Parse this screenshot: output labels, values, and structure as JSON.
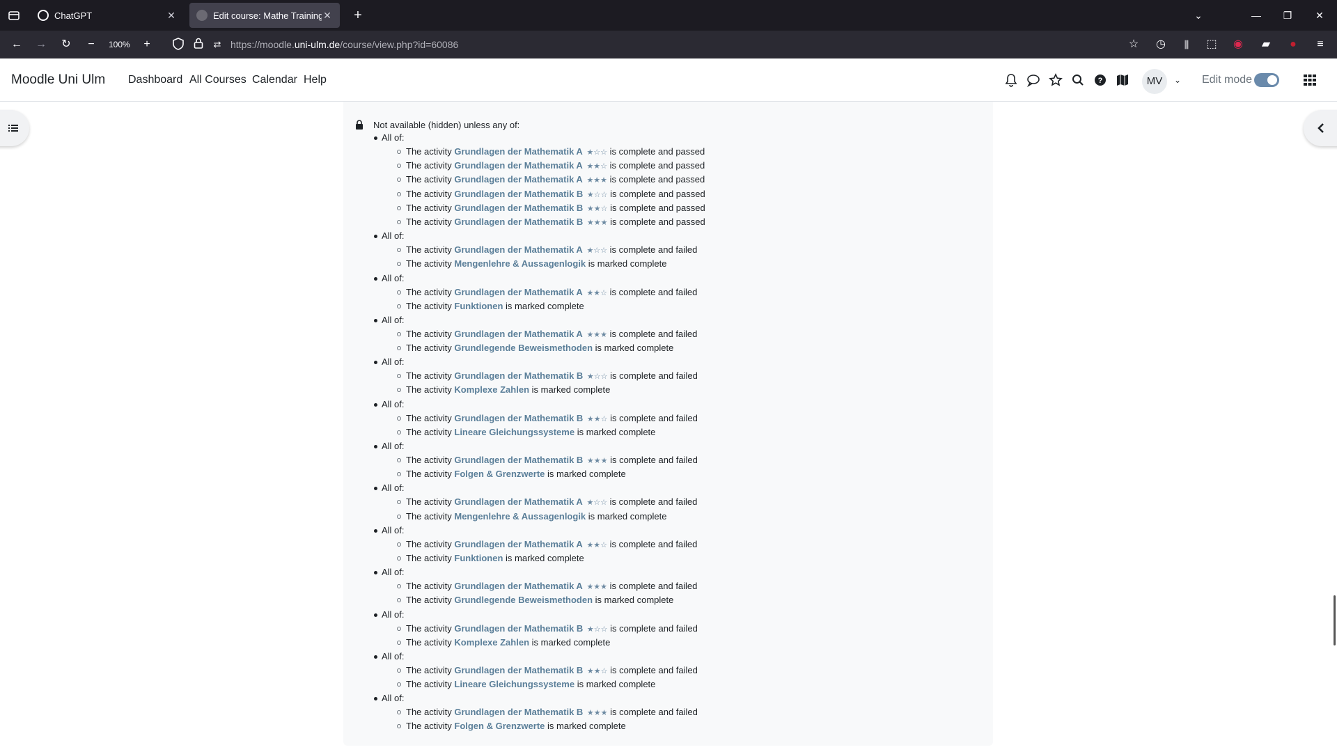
{
  "browser": {
    "tabs": [
      {
        "title": "ChatGPT",
        "active": false
      },
      {
        "title": "Edit course: Mathe Training | Mo",
        "active": true
      }
    ],
    "zoom": "100%",
    "url_prefix": "https://moodle.",
    "url_domain": "uni-ulm.de",
    "url_path": "/course/view.php?id=60086"
  },
  "moodle": {
    "brand": "Moodle Uni Ulm",
    "nav": [
      "Dashboard",
      "All Courses",
      "Calendar",
      "Help"
    ],
    "user_initials": "MV",
    "edit_mode_label": "Edit mode",
    "edit_mode_on": true
  },
  "restriction": {
    "heading": "Not available (hidden) unless any of:",
    "group_label": "All of:",
    "prefix": "The activity",
    "groups": [
      {
        "conditions": [
          {
            "activity": "Grundlagen der Mathematik A",
            "stars": "★☆☆",
            "suffix": "is complete and passed"
          },
          {
            "activity": "Grundlagen der Mathematik A",
            "stars": "★★☆",
            "suffix": "is complete and passed"
          },
          {
            "activity": "Grundlagen der Mathematik A",
            "stars": "★★★",
            "suffix": "is complete and passed"
          },
          {
            "activity": "Grundlagen der Mathematik B",
            "stars": "★☆☆",
            "suffix": "is complete and passed"
          },
          {
            "activity": "Grundlagen der Mathematik B",
            "stars": "★★☆",
            "suffix": "is complete and passed"
          },
          {
            "activity": "Grundlagen der Mathematik B",
            "stars": "★★★",
            "suffix": "is complete and passed"
          }
        ]
      },
      {
        "conditions": [
          {
            "activity": "Grundlagen der Mathematik A",
            "stars": "★☆☆",
            "suffix": "is complete and failed"
          },
          {
            "activity": "Mengenlehre & Aussagenlogik",
            "stars": "",
            "suffix": "is marked complete"
          }
        ]
      },
      {
        "conditions": [
          {
            "activity": "Grundlagen der Mathematik A",
            "stars": "★★☆",
            "suffix": "is complete and failed"
          },
          {
            "activity": "Funktionen",
            "stars": "",
            "suffix": "is marked complete"
          }
        ]
      },
      {
        "conditions": [
          {
            "activity": "Grundlagen der Mathematik A",
            "stars": "★★★",
            "suffix": "is complete and failed"
          },
          {
            "activity": "Grundlegende Beweismethoden",
            "stars": "",
            "suffix": "is marked complete"
          }
        ]
      },
      {
        "conditions": [
          {
            "activity": "Grundlagen der Mathematik B",
            "stars": "★☆☆",
            "suffix": "is complete and failed"
          },
          {
            "activity": "Komplexe Zahlen",
            "stars": "",
            "suffix": "is marked complete"
          }
        ]
      },
      {
        "conditions": [
          {
            "activity": "Grundlagen der Mathematik B",
            "stars": "★★☆",
            "suffix": "is complete and failed"
          },
          {
            "activity": "Lineare Gleichungssysteme",
            "stars": "",
            "suffix": "is marked complete"
          }
        ]
      },
      {
        "conditions": [
          {
            "activity": "Grundlagen der Mathematik B",
            "stars": "★★★",
            "suffix": "is complete and failed"
          },
          {
            "activity": "Folgen & Grenzwerte",
            "stars": "",
            "suffix": "is marked complete"
          }
        ]
      },
      {
        "conditions": [
          {
            "activity": "Grundlagen der Mathematik A",
            "stars": "★☆☆",
            "suffix": "is complete and failed"
          },
          {
            "activity": "Mengenlehre & Aussagenlogik",
            "stars": "",
            "suffix": "is marked complete"
          }
        ]
      },
      {
        "conditions": [
          {
            "activity": "Grundlagen der Mathematik A",
            "stars": "★★☆",
            "suffix": "is complete and failed"
          },
          {
            "activity": "Funktionen",
            "stars": "",
            "suffix": "is marked complete"
          }
        ]
      },
      {
        "conditions": [
          {
            "activity": "Grundlagen der Mathematik A",
            "stars": "★★★",
            "suffix": "is complete and failed"
          },
          {
            "activity": "Grundlegende Beweismethoden",
            "stars": "",
            "suffix": "is marked complete"
          }
        ]
      },
      {
        "conditions": [
          {
            "activity": "Grundlagen der Mathematik B",
            "stars": "★☆☆",
            "suffix": "is complete and failed"
          },
          {
            "activity": "Komplexe Zahlen",
            "stars": "",
            "suffix": "is marked complete"
          }
        ]
      },
      {
        "conditions": [
          {
            "activity": "Grundlagen der Mathematik B",
            "stars": "★★☆",
            "suffix": "is complete and failed"
          },
          {
            "activity": "Lineare Gleichungssysteme",
            "stars": "",
            "suffix": "is marked complete"
          }
        ]
      },
      {
        "conditions": [
          {
            "activity": "Grundlagen der Mathematik B",
            "stars": "★★★",
            "suffix": "is complete and failed"
          },
          {
            "activity": "Folgen & Grenzwerte",
            "stars": "",
            "suffix": "is marked complete"
          }
        ]
      }
    ]
  }
}
